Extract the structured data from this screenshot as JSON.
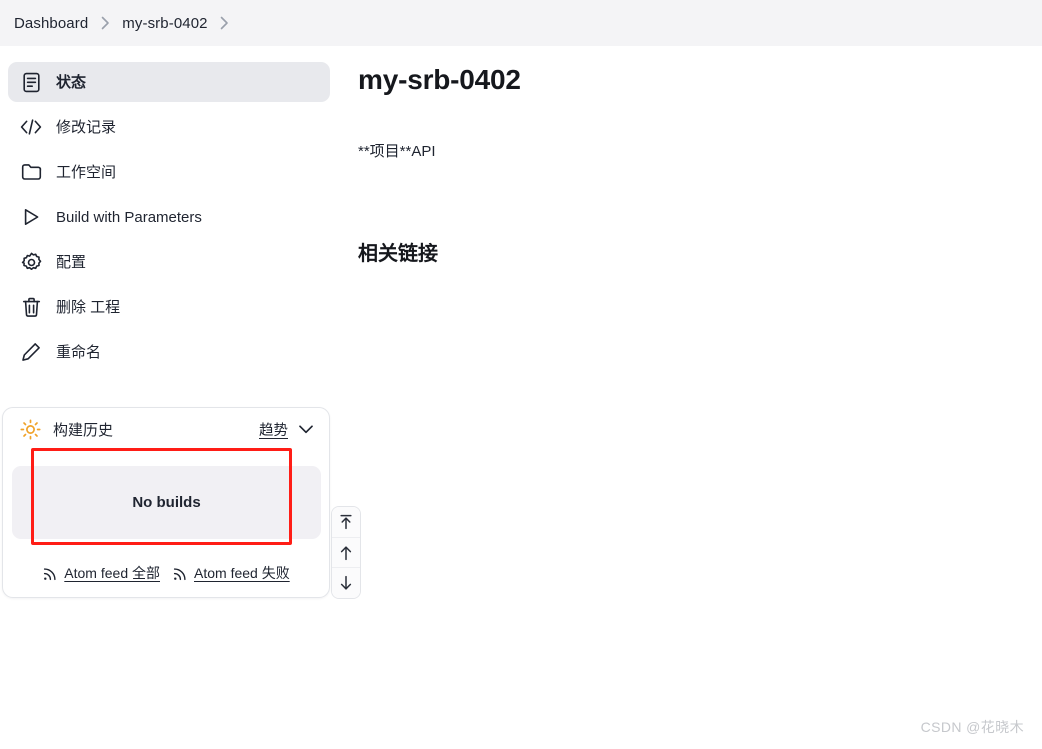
{
  "breadcrumb": {
    "items": [
      {
        "label": "Dashboard"
      },
      {
        "label": "my-srb-0402"
      }
    ],
    "separator_icon": "chevron-right-icon"
  },
  "sidebar": {
    "items": [
      {
        "label": "状态",
        "icon": "document-status-icon",
        "active": true
      },
      {
        "label": "修改记录",
        "icon": "code-brackets-icon",
        "active": false
      },
      {
        "label": "工作空间",
        "icon": "folder-icon",
        "active": false
      },
      {
        "label": "Build with Parameters",
        "icon": "play-triangle-icon",
        "active": false
      },
      {
        "label": "配置",
        "icon": "gear-icon",
        "active": false
      },
      {
        "label": "删除 工程",
        "icon": "trash-icon",
        "active": false
      },
      {
        "label": "重命名",
        "icon": "pencil-icon",
        "active": false
      }
    ]
  },
  "build_history": {
    "icon": "sun-weather-icon",
    "title": "构建历史",
    "trend_label": "趋势",
    "trend_chevron_icon": "chevron-down-icon",
    "empty_text": "No builds",
    "feeds": [
      {
        "label": "Atom feed 全部",
        "icon": "rss-icon"
      },
      {
        "label": "Atom feed 失败",
        "icon": "rss-icon"
      }
    ]
  },
  "scroll_controls": {
    "buttons": [
      {
        "icon": "jump-to-top-icon"
      },
      {
        "icon": "arrow-up-icon"
      },
      {
        "icon": "arrow-down-icon"
      }
    ]
  },
  "main": {
    "title": "my-srb-0402",
    "description": "**项目**API",
    "related_links_heading": "相关链接"
  },
  "watermark": {
    "text": "CSDN @花晓木"
  },
  "colors": {
    "header_bg": "#f4f4f6",
    "active_item_bg": "#e8e9ed",
    "empty_panel_bg": "#f1f0f4",
    "annotation_red": "#ff1d16",
    "sun_orange": "#f0a229",
    "text": "#1f2430"
  }
}
